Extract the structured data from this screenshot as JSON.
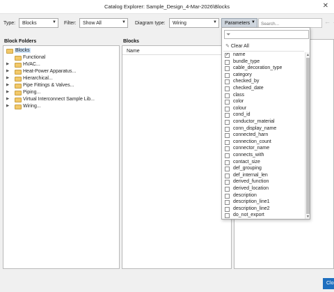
{
  "window": {
    "title": "Catalog Explorer: Sample_Design_4-Mar-2026\\Blocks",
    "close_glyph": "✕"
  },
  "toolbar": {
    "type_label": "Type:",
    "type_value": "Blocks",
    "filter_label": "Filter:",
    "filter_value": "Show All",
    "diagram_label": "Diagram type:",
    "diagram_value": "Wiring",
    "parameters_label": "Parameters",
    "search_placeholder": "Search...",
    "back_icon": "←",
    "forward_icon": "→"
  },
  "block_folders": {
    "title": "Block Folders",
    "root": "Blocks",
    "items": [
      {
        "label": "Functional",
        "expandable": false
      },
      {
        "label": "HVAC...",
        "expandable": true
      },
      {
        "label": "Heat-Power Apparatus...",
        "expandable": true
      },
      {
        "label": "Hierarchical...",
        "expandable": true
      },
      {
        "label": "Pipe Fittings & Valves...",
        "expandable": true
      },
      {
        "label": "Piping...",
        "expandable": true
      },
      {
        "label": "Virtual Interconnect Sample Lib...",
        "expandable": true
      },
      {
        "label": "Wiring...",
        "expandable": true
      }
    ]
  },
  "blocks": {
    "title": "Blocks",
    "column_name": "Name"
  },
  "parameters_dropdown": {
    "clear_all": "Clear All",
    "items": [
      {
        "label": "name",
        "checked": true
      },
      {
        "label": "bundle_type",
        "checked": false
      },
      {
        "label": "cable_decoration_type",
        "checked": false
      },
      {
        "label": "category",
        "checked": false
      },
      {
        "label": "checked_by",
        "checked": false
      },
      {
        "label": "checked_date",
        "checked": false
      },
      {
        "label": "class",
        "checked": false
      },
      {
        "label": "color",
        "checked": false
      },
      {
        "label": "colour",
        "checked": false
      },
      {
        "label": "cond_id",
        "checked": false
      },
      {
        "label": "conductor_material",
        "checked": false
      },
      {
        "label": "conn_display_name",
        "checked": false
      },
      {
        "label": "connected_harn",
        "checked": false
      },
      {
        "label": "connection_count",
        "checked": false
      },
      {
        "label": "connector_name",
        "checked": false
      },
      {
        "label": "connects_with",
        "checked": false
      },
      {
        "label": "contact_size",
        "checked": false
      },
      {
        "label": "def_grouping",
        "checked": false
      },
      {
        "label": "def_internal_len",
        "checked": false
      },
      {
        "label": "derived_function",
        "checked": false
      },
      {
        "label": "derived_location",
        "checked": false
      },
      {
        "label": "description",
        "checked": false
      },
      {
        "label": "description_line1",
        "checked": false
      },
      {
        "label": "description_line2",
        "checked": false
      },
      {
        "label": "do_not_export",
        "checked": false
      }
    ]
  },
  "footer": {
    "close_label": "Close"
  }
}
